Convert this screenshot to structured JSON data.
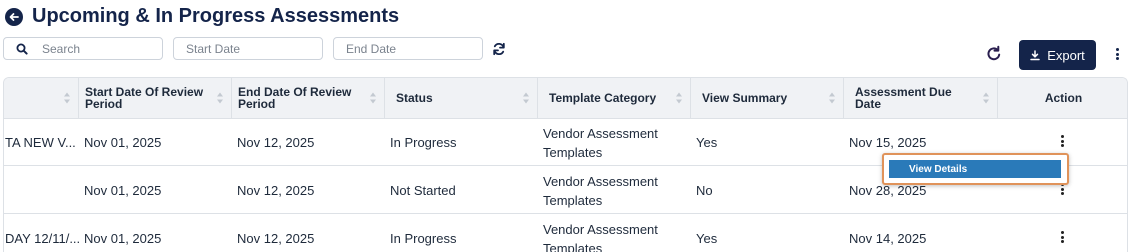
{
  "header": {
    "title": "Upcoming & In Progress Assessments",
    "back_icon": "arrow-left-circle-icon"
  },
  "filters": {
    "search_placeholder": "Search",
    "start_date_placeholder": "Start Date",
    "end_date_placeholder": "End Date"
  },
  "toolbar": {
    "export_label": "Export"
  },
  "table": {
    "columns": [
      "",
      "Start Date Of Review Period",
      "End Date Of Review Period",
      "Status",
      "Template Category",
      "View Summary",
      "Assessment Due Date",
      "Action"
    ],
    "rows": [
      {
        "name": "TA NEW V...",
        "start": "Nov 01, 2025",
        "end": "Nov 12, 2025",
        "status": "In Progress",
        "category": "Vendor Assessment Templates",
        "summary": "Yes",
        "due": "Nov 15, 2025"
      },
      {
        "name": "",
        "start": "Nov 01, 2025",
        "end": "Nov 12, 2025",
        "status": "Not Started",
        "category": "Vendor Assessment Templates",
        "summary": "No",
        "due": "Nov 28, 2025"
      },
      {
        "name": "DAY 12/11/...",
        "start": "Nov 01, 2025",
        "end": "Nov 12, 2025",
        "status": "In Progress",
        "category": "Vendor Assessment Templates",
        "summary": "Yes",
        "due": "Nov 14, 2025"
      }
    ]
  },
  "context_menu": {
    "items": [
      "View Details"
    ]
  },
  "colors": {
    "brand_navy": "#14244a",
    "menu_highlight": "#2a7ab9",
    "menu_outline": "#e0935a"
  }
}
